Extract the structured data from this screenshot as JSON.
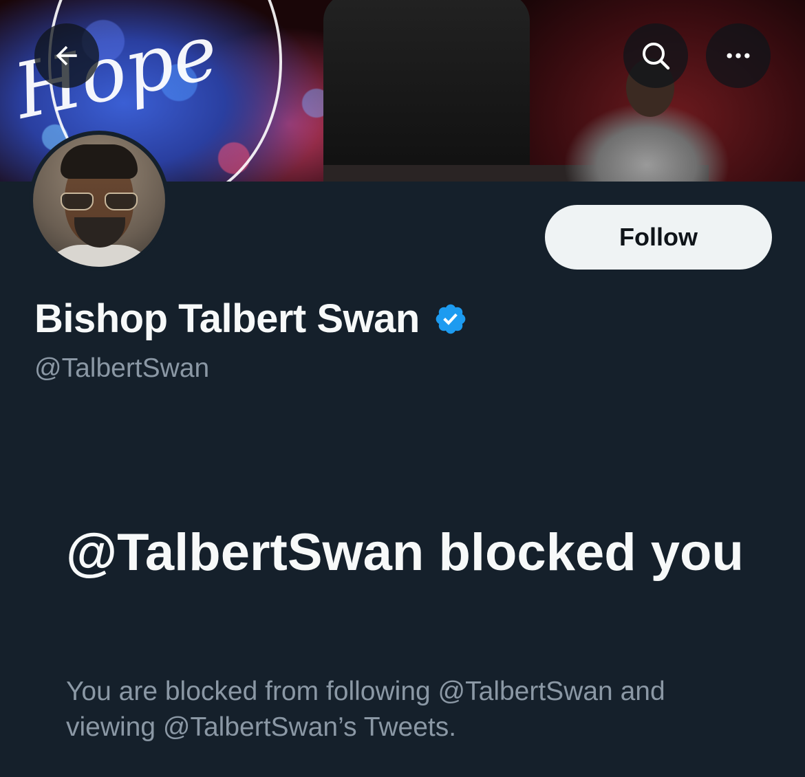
{
  "header": {
    "back_icon": "arrow-left-icon",
    "search_icon": "search-icon",
    "more_icon": "more-horizontal-icon",
    "banner_text": "Hope"
  },
  "profile": {
    "display_name": "Bishop Talbert Swan",
    "handle": "@TalbertSwan",
    "verified": true,
    "verified_color": "#1d9bf0",
    "follow_label": "Follow"
  },
  "blocked": {
    "title": "@TalbertSwan blocked you",
    "description": "You are blocked from following @TalbertSwan and viewing @TalbertSwan’s Tweets."
  },
  "colors": {
    "background": "#15202b",
    "primary_text": "#f7f9f9",
    "secondary_text": "#8b98a5",
    "button_bg": "#eff3f4"
  }
}
